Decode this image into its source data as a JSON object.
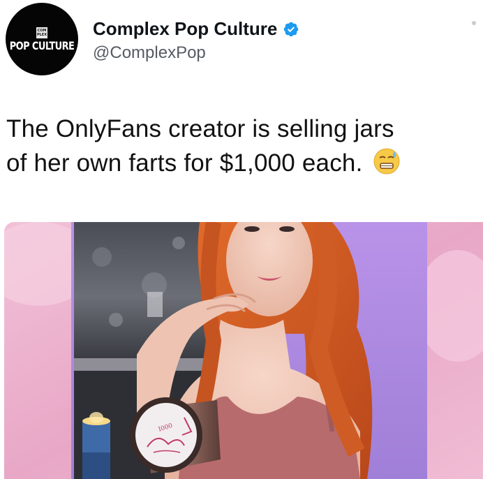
{
  "tweet": {
    "author": {
      "display_name": "Complex Pop Culture",
      "handle": "@ComplexPop",
      "avatar_text": "POP CULTURE",
      "avatar_mini_text": "COM PLEX",
      "verified": true
    },
    "text_lines": [
      "The OnlyFans creator is selling jars",
      "of her own farts for $1,000 each."
    ],
    "emoji": "grimacing-sweat-emoji",
    "media": {
      "type": "photo",
      "jar_label_text": "♪ 1000 KISSES"
    }
  },
  "colors": {
    "verified_blue": "#1d9bf0",
    "text_primary": "#0f1419",
    "text_secondary": "#555b61",
    "hair": "#d05a20",
    "backdrop_pink": "#e9a8c8",
    "backdrop_lavender": "#b08fe0"
  }
}
